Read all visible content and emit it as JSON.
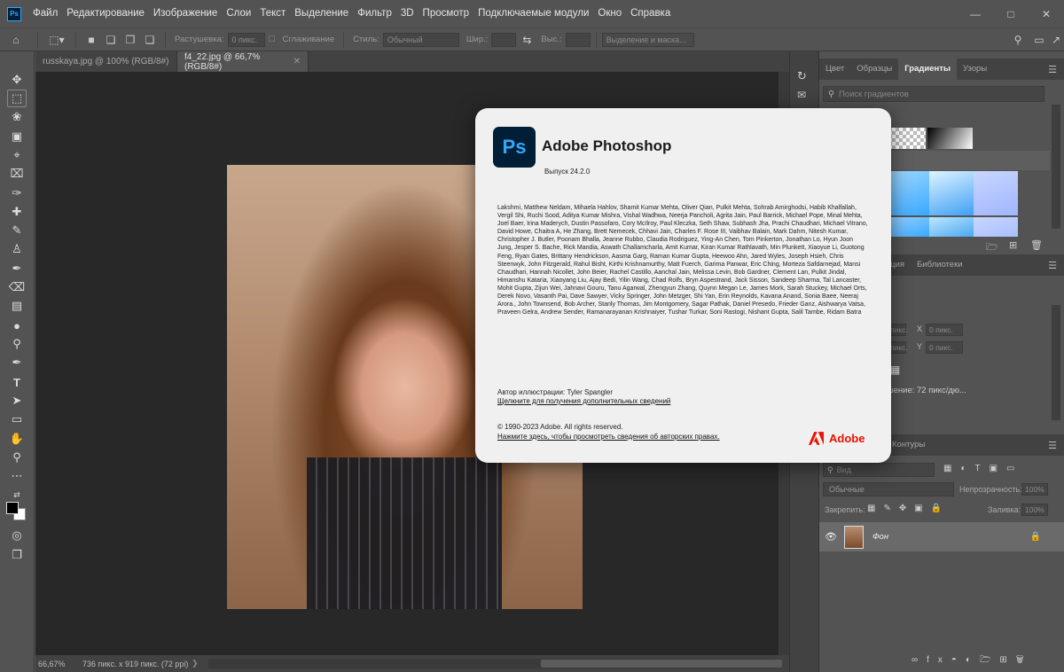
{
  "menubar": {
    "items": [
      "Файл",
      "Редактирование",
      "Изображение",
      "Слои",
      "Текст",
      "Выделение",
      "Фильтр",
      "3D",
      "Просмотр",
      "Подключаемые модули",
      "Окно",
      "Справка"
    ],
    "logo": "Ps"
  },
  "options": {
    "feather_label": "Растушевка:",
    "feather_value": "0 пикс.",
    "antialias_label": "Сглаживание",
    "style_label": "Стиль:",
    "style_value": "Обычный",
    "width_label": "Шир.:",
    "height_label": "Выс.:",
    "select_mask_label": "Выделение и маска..."
  },
  "tabs": [
    {
      "label": "russkaya.jpg @ 100% (RGB/8#)",
      "active": false
    },
    {
      "label": "f4_22.jpg @ 66,7% (RGB/8#)",
      "active": true
    }
  ],
  "status": {
    "zoom": "66,67%",
    "doc_size": "736 пикс. x 919 пикс. (72 ppi)"
  },
  "about": {
    "icon": "Ps",
    "app_name": "Adobe Photoshop",
    "version": "Выпуск 24.2.0",
    "credits": "Lakshmi, Matthew Neldam, Mihaela Hahlov, Shamit Kumar Mehta, Oliver Qian, Pulkit Mehta, Sohrab Amirghodsi, Habib Khalfallah, Vergil Shi, Ruchi Sood, Aditya Kumar Mishra, Vishal Wadhwa, Neerja Pancholi, Agrita Jain, Paul Barrick, Michael Pope, Minal Mehta, Joel Baer, Irina Maderych, Dustin Passofaro, Cory McIlroy, Paul Kleczka, Seth Shaw, Subhash Jha, Prachi Chaudhari, Michael Vitrano, David Howe, Chaitra A, He Zhang, Brett Nemecek, Chhavi Jain, Charles F. Rose III, Vaibhav Balain, Mark Dahm, Nitesh Kumar, Christopher J. Butler, Poonam Bhalla, Jeanne Rubbo, Claudia Rodriguez, Ying-An Chen, Tom Pinkerton, Jonathan Lo, Hyun Joon Jung, Jesper S. Bache, Rick Mandia, Aswath Challamcharla, Amit Kumar, Kiran Kumar Rathlavath, Min Plunkett, Xiaoyue Li, Guotong Feng, Ryan Gates, Brittany Hendrickson, Aasma Garg, Raman Kumar Gupta, Heewoo Ahn, Jared Wyles, Joseph Hsieh, Chris Steenwyk, John Fitzgerald, Rahul Bisht, Kirthi Krishnamurthy, Matt Fuerch, Garima Panwar, Eric Ching, Morteza Safdarnejad, Mansi Chaudhari, Hannah Nicollet, John Beier, Rachel Castillo, Aanchal Jain, Melissa Levin, Bob Gardner, Clement Lan, Pulkit Jindal, Himanshu Kataria, Xiaoyang Liu, Ajay Bedi, Yilin Wang, Chad Rolfs, Bryn Aspestrand, Jack Sisson, Sandeep Sharma, Tal Lancaster, Mohit Gupta, Zijun Wei, Jahnavi Gouru, Tanu Agarwal, Zhengyun Zhang, Quynn Megan Le, James Mork, Sarah Stuckey, Michael Orts, Derek Novo, Vasanth Pai, Dave Sawyer, Vicky Springer, John Metzger, Shi Yan, Erin Reynolds, Kavana Anand, Sonia Baee, Neeraj Arora., John Townsend, Bob Archer, Stanly Thomas, Jim Montgomery, Sagar Pathak, Daniel Presedo, Frieder Ganz, Aishwarya Vatsa, Praveen Gelra, Andrew Sender, Ramanarayanan Krishnaiyer, Tushar Turkar, Soni Rastogi, Nishant Gupta, Salil Tambe, Ridam Batra",
    "illustration": "Автор иллюстрации: Tyler Spangler",
    "more_link": "Щелкните для получения дополнительных сведений",
    "copyright": "© 1990-2023 Adobe. All rights reserved.",
    "rights_link": "Нажмите здесь, чтобы просмотреть сведения об авторских правах.",
    "adobe_word": "Adobe"
  },
  "gradients_panel": {
    "tabs": [
      "Цвет",
      "Образцы",
      "Градиенты",
      "Узоры"
    ],
    "active": "Градиенты",
    "search_placeholder": "Поиск градиентов"
  },
  "properties_panel": {
    "tabs": [
      "кция",
      "Библиотеки"
    ],
    "x_label": "X",
    "y_label": "Y",
    "x_value": "0 пикс.",
    "y_value": "0 пикс.",
    "field_a": "пикс.",
    "field_b": "пикс.",
    "resolution": "шение: 72 пикс/дю..."
  },
  "layers_panel": {
    "tabs": [
      "Контуры"
    ],
    "filter_placeholder": "Вид",
    "blend_mode": "Обычные",
    "opacity_label": "Непрозрачность:",
    "opacity_value": "100%",
    "lock_label": "Закрепить:",
    "fill_label": "Заливка:",
    "fill_value": "100%",
    "layer_name": "Фон"
  }
}
